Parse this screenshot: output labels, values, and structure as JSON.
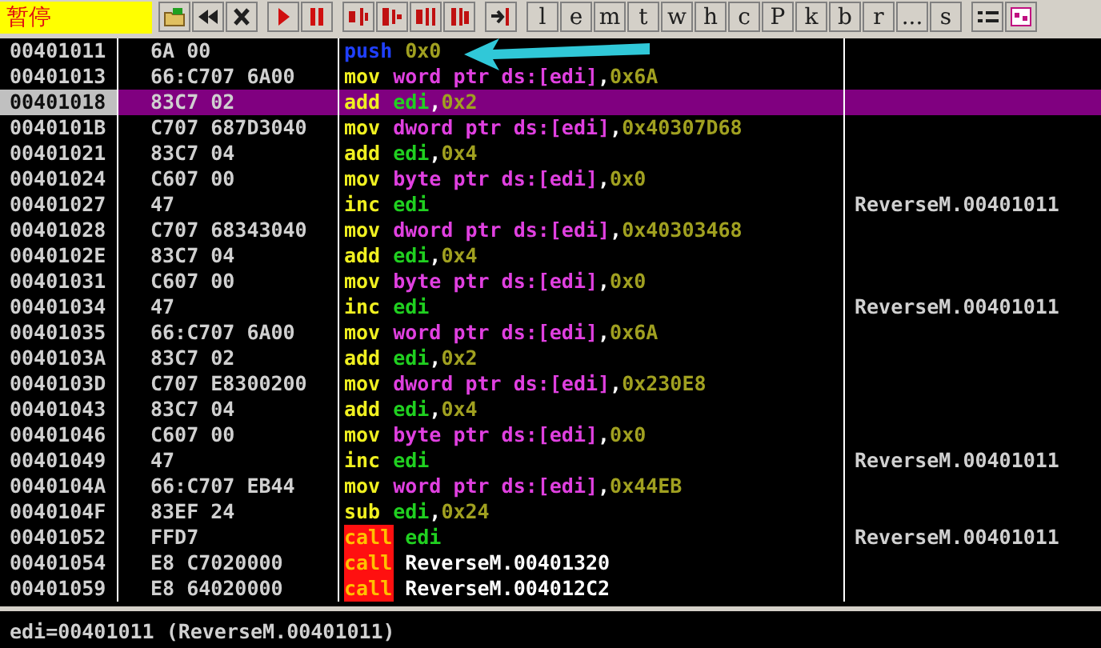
{
  "status": "暂停",
  "toolbar_letters": [
    "l",
    "e",
    "m",
    "t",
    "w",
    "h",
    "c",
    "P",
    "k",
    "b",
    "r",
    "...",
    "s"
  ],
  "rows": [
    {
      "address": "00401011",
      "hex": "6A 00",
      "mnemonic": "push",
      "kind": "push",
      "operands": [
        {
          "text": "0x0",
          "kind": "num"
        }
      ],
      "selected": false
    },
    {
      "address": "00401013",
      "hex": "66:C707 6A00",
      "mnemonic": "mov",
      "kind": "normal",
      "operands": [
        {
          "text": "word ptr ds:[edi]",
          "kind": "mem"
        },
        {
          "text": ",",
          "kind": "sep"
        },
        {
          "text": "0x6A",
          "kind": "num"
        }
      ],
      "selected": false
    },
    {
      "address": "00401018",
      "hex": "83C7 02",
      "mnemonic": "add",
      "kind": "normal",
      "operands": [
        {
          "text": "edi",
          "kind": "reg"
        },
        {
          "text": ",",
          "kind": "sep"
        },
        {
          "text": "0x2",
          "kind": "num"
        }
      ],
      "selected": true
    },
    {
      "address": "0040101B",
      "hex": "C707 687D3040",
      "mnemonic": "mov",
      "kind": "normal",
      "operands": [
        {
          "text": "dword ptr ds:[edi]",
          "kind": "mem"
        },
        {
          "text": ",",
          "kind": "sep"
        },
        {
          "text": "0x40307D68",
          "kind": "num"
        }
      ],
      "selected": false
    },
    {
      "address": "00401021",
      "hex": "83C7 04",
      "mnemonic": "add",
      "kind": "normal",
      "operands": [
        {
          "text": "edi",
          "kind": "reg"
        },
        {
          "text": ",",
          "kind": "sep"
        },
        {
          "text": "0x4",
          "kind": "num"
        }
      ],
      "selected": false
    },
    {
      "address": "00401024",
      "hex": "C607 00",
      "mnemonic": "mov",
      "kind": "normal",
      "operands": [
        {
          "text": "byte ptr ds:[edi]",
          "kind": "mem"
        },
        {
          "text": ",",
          "kind": "sep"
        },
        {
          "text": "0x0",
          "kind": "num"
        }
      ],
      "selected": false
    },
    {
      "address": "00401027",
      "hex": "47",
      "mnemonic": "inc",
      "kind": "normal",
      "operands": [
        {
          "text": "edi",
          "kind": "reg"
        }
      ],
      "comment": "ReverseM.00401011",
      "selected": false
    },
    {
      "address": "00401028",
      "hex": "C707 68343040",
      "mnemonic": "mov",
      "kind": "normal",
      "operands": [
        {
          "text": "dword ptr ds:[edi]",
          "kind": "mem"
        },
        {
          "text": ",",
          "kind": "sep"
        },
        {
          "text": "0x40303468",
          "kind": "num"
        }
      ],
      "selected": false
    },
    {
      "address": "0040102E",
      "hex": "83C7 04",
      "mnemonic": "add",
      "kind": "normal",
      "operands": [
        {
          "text": "edi",
          "kind": "reg"
        },
        {
          "text": ",",
          "kind": "sep"
        },
        {
          "text": "0x4",
          "kind": "num"
        }
      ],
      "selected": false
    },
    {
      "address": "00401031",
      "hex": "C607 00",
      "mnemonic": "mov",
      "kind": "normal",
      "operands": [
        {
          "text": "byte ptr ds:[edi]",
          "kind": "mem"
        },
        {
          "text": ",",
          "kind": "sep"
        },
        {
          "text": "0x0",
          "kind": "num"
        }
      ],
      "selected": false
    },
    {
      "address": "00401034",
      "hex": "47",
      "mnemonic": "inc",
      "kind": "normal",
      "operands": [
        {
          "text": "edi",
          "kind": "reg"
        }
      ],
      "comment": "ReverseM.00401011",
      "selected": false
    },
    {
      "address": "00401035",
      "hex": "66:C707 6A00",
      "mnemonic": "mov",
      "kind": "normal",
      "operands": [
        {
          "text": "word ptr ds:[edi]",
          "kind": "mem"
        },
        {
          "text": ",",
          "kind": "sep"
        },
        {
          "text": "0x6A",
          "kind": "num"
        }
      ],
      "selected": false
    },
    {
      "address": "0040103A",
      "hex": "83C7 02",
      "mnemonic": "add",
      "kind": "normal",
      "operands": [
        {
          "text": "edi",
          "kind": "reg"
        },
        {
          "text": ",",
          "kind": "sep"
        },
        {
          "text": "0x2",
          "kind": "num"
        }
      ],
      "selected": false
    },
    {
      "address": "0040103D",
      "hex": "C707 E8300200",
      "mnemonic": "mov",
      "kind": "normal",
      "operands": [
        {
          "text": "dword ptr ds:[edi]",
          "kind": "mem"
        },
        {
          "text": ",",
          "kind": "sep"
        },
        {
          "text": "0x230E8",
          "kind": "num"
        }
      ],
      "selected": false
    },
    {
      "address": "00401043",
      "hex": "83C7 04",
      "mnemonic": "add",
      "kind": "normal",
      "operands": [
        {
          "text": "edi",
          "kind": "reg"
        },
        {
          "text": ",",
          "kind": "sep"
        },
        {
          "text": "0x4",
          "kind": "num"
        }
      ],
      "selected": false
    },
    {
      "address": "00401046",
      "hex": "C607 00",
      "mnemonic": "mov",
      "kind": "normal",
      "operands": [
        {
          "text": "byte ptr ds:[edi]",
          "kind": "mem"
        },
        {
          "text": ",",
          "kind": "sep"
        },
        {
          "text": "0x0",
          "kind": "num"
        }
      ],
      "selected": false
    },
    {
      "address": "00401049",
      "hex": "47",
      "mnemonic": "inc",
      "kind": "normal",
      "operands": [
        {
          "text": "edi",
          "kind": "reg"
        }
      ],
      "comment": "ReverseM.00401011",
      "selected": false
    },
    {
      "address": "0040104A",
      "hex": "66:C707 EB44",
      "mnemonic": "mov",
      "kind": "normal",
      "operands": [
        {
          "text": "word ptr ds:[edi]",
          "kind": "mem"
        },
        {
          "text": ",",
          "kind": "sep"
        },
        {
          "text": "0x44EB",
          "kind": "num"
        }
      ],
      "selected": false
    },
    {
      "address": "0040104F",
      "hex": "83EF 24",
      "mnemonic": "sub",
      "kind": "normal",
      "operands": [
        {
          "text": "edi",
          "kind": "reg"
        },
        {
          "text": ",",
          "kind": "sep"
        },
        {
          "text": "0x24",
          "kind": "num"
        }
      ],
      "selected": false
    },
    {
      "address": "00401052",
      "hex": "FFD7",
      "mnemonic": "call",
      "kind": "call",
      "operands": [
        {
          "text": "edi",
          "kind": "reg"
        }
      ],
      "comment": "ReverseM.00401011",
      "selected": false
    },
    {
      "address": "00401054",
      "hex": "E8 C7020000",
      "mnemonic": "call",
      "kind": "call",
      "operands": [
        {
          "text": "ReverseM.00401320",
          "kind": "ref"
        }
      ],
      "selected": false
    },
    {
      "address": "00401059",
      "hex": "E8 64020000",
      "mnemonic": "call",
      "kind": "call",
      "operands": [
        {
          "text": "ReverseM.004012C2",
          "kind": "ref"
        }
      ],
      "selected": false
    }
  ],
  "info": "edi=00401011 (ReverseM.00401011)"
}
